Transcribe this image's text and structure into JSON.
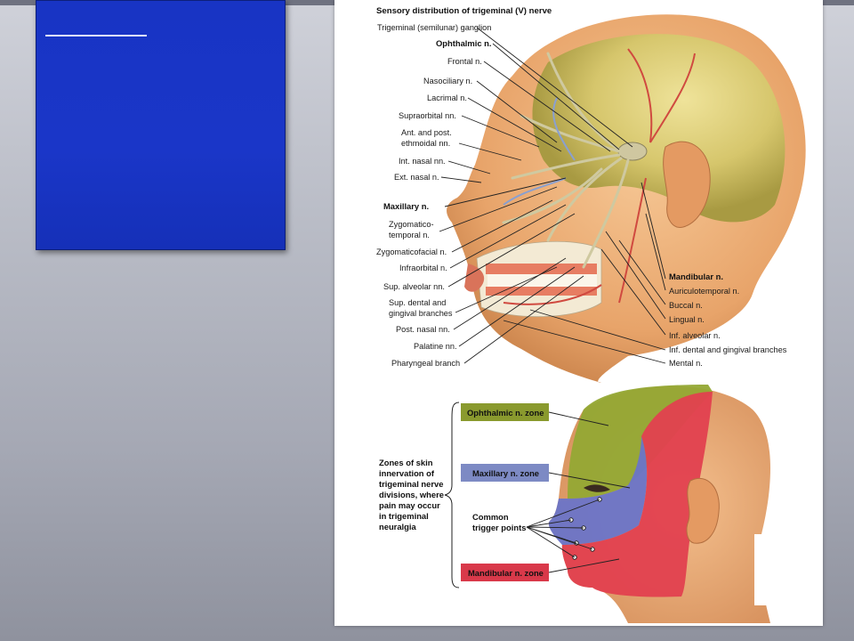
{
  "slide": {
    "title_placeholder": ""
  },
  "top_figure": {
    "title": "Sensory distribution of trigeminal (V) nerve",
    "left_labels": [
      {
        "text": "Trigeminal (semilunar) ganglion",
        "bold": false
      },
      {
        "text": "Ophthalmic n.",
        "bold": true
      },
      {
        "text": "Frontal n.",
        "bold": false
      },
      {
        "text": "Nasociliary n.",
        "bold": false
      },
      {
        "text": "Lacrimal n.",
        "bold": false
      },
      {
        "text": "Supraorbital nn.",
        "bold": false
      },
      {
        "text": "Ant. and post.",
        "bold": false
      },
      {
        "text": "ethmoidal nn.",
        "bold": false
      },
      {
        "text": "Int. nasal nn.",
        "bold": false
      },
      {
        "text": "Ext. nasal n.",
        "bold": false
      },
      {
        "text": "Maxillary n.",
        "bold": true
      },
      {
        "text": "Zygomatico-",
        "bold": false
      },
      {
        "text": "temporal n.",
        "bold": false
      },
      {
        "text": "Zygomaticofacial n.",
        "bold": false
      },
      {
        "text": "Infraorbital n.",
        "bold": false
      },
      {
        "text": "Sup. alveolar nn.",
        "bold": false
      },
      {
        "text": "Sup. dental and",
        "bold": false
      },
      {
        "text": "gingival branches",
        "bold": false
      },
      {
        "text": "Post. nasal nn.",
        "bold": false
      },
      {
        "text": "Palatine nn.",
        "bold": false
      },
      {
        "text": "Pharyngeal branch",
        "bold": false
      }
    ],
    "right_labels": [
      {
        "text": "Mandibular n.",
        "bold": true
      },
      {
        "text": "Auriculotemporal n.",
        "bold": false
      },
      {
        "text": "Buccal n.",
        "bold": false
      },
      {
        "text": "Lingual n.",
        "bold": false
      },
      {
        "text": "Inf. alveolar n.",
        "bold": false
      },
      {
        "text": "Inf. dental and gingival branches",
        "bold": false
      },
      {
        "text": "Mental n.",
        "bold": false
      }
    ]
  },
  "bottom_figure": {
    "zones": [
      {
        "label": "Ophthalmic n. zone",
        "color": "#8a9a2e"
      },
      {
        "label": "Maxillary n. zone",
        "color": "#7d8ac4"
      },
      {
        "label": "Mandibular n. zone",
        "color": "#d9394a"
      }
    ],
    "note_lines": [
      "Zones of skin",
      "innervation of",
      "trigeminal nerve",
      "divisions, where",
      "pain may occur",
      "in trigeminal",
      "neuralgia"
    ],
    "trigger_lines": [
      "Common",
      "trigger points"
    ]
  },
  "colors": {
    "ophthalmic_zone": "#94a834",
    "maxillary_zone": "#6a74c8",
    "mandibular_zone": "#e2404f",
    "skin": "#f0b27a",
    "nerve": "#d8d2a6"
  }
}
